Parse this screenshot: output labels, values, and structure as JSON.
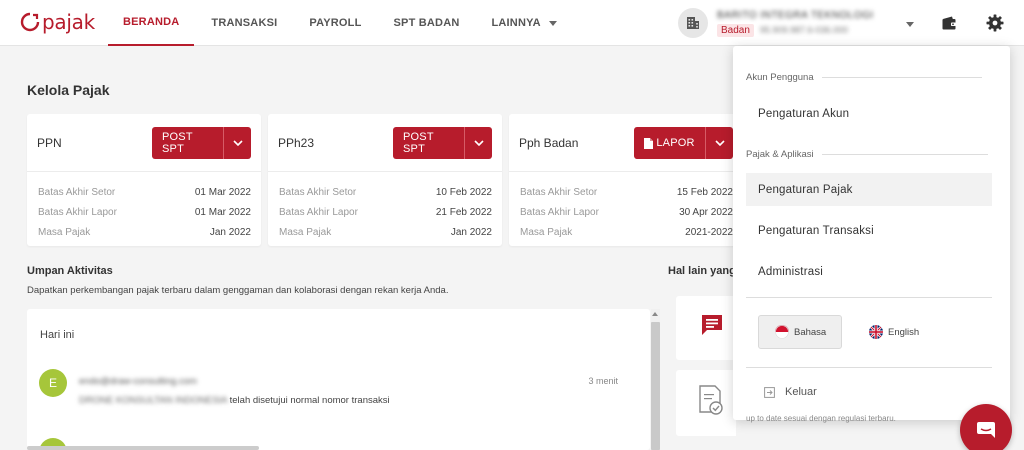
{
  "brand": {
    "logo_text": "pajak",
    "color": "#b71c2c"
  },
  "nav": {
    "items": [
      {
        "label": "BERANDA",
        "active": true
      },
      {
        "label": "TRANSAKSI",
        "active": false
      },
      {
        "label": "PAYROLL",
        "active": false
      },
      {
        "label": "SPT BADAN",
        "active": false
      },
      {
        "label": "LAINNYA",
        "active": false
      }
    ]
  },
  "company": {
    "name": "BARITO INTEGRA TEKNOLOGI",
    "type_badge": "Badan",
    "npwp": "95.909.987.6-036.000"
  },
  "main": {
    "title": "Kelola Pajak",
    "cards": [
      {
        "name": "PPN",
        "action_label": "POST SPT",
        "action_icon": "",
        "rows": [
          {
            "k": "Batas Akhir Setor",
            "v": "01 Mar 2022"
          },
          {
            "k": "Batas Akhir Lapor",
            "v": "01 Mar 2022"
          },
          {
            "k": "Masa Pajak",
            "v": "Jan 2022"
          }
        ]
      },
      {
        "name": "PPh23",
        "action_label": "POST SPT",
        "action_icon": "",
        "rows": [
          {
            "k": "Batas Akhir Setor",
            "v": "10 Feb 2022"
          },
          {
            "k": "Batas Akhir Lapor",
            "v": "21 Feb 2022"
          },
          {
            "k": "Masa Pajak",
            "v": "Jan 2022"
          }
        ]
      },
      {
        "name": "Pph Badan",
        "action_label": "LAPOR",
        "action_icon": "document-icon",
        "rows": [
          {
            "k": "Batas Akhir Setor",
            "v": "15 Feb 2022"
          },
          {
            "k": "Batas Akhir Lapor",
            "v": "30 Apr 2022"
          },
          {
            "k": "Masa Pajak",
            "v": "2021-2022"
          }
        ]
      }
    ],
    "activity": {
      "title": "Umpan Aktivitas",
      "description": "Dapatkan perkembangan pajak terbaru dalam genggaman dan kolaborasi dengan rekan kerja Anda.",
      "today_label": "Hari ini",
      "items": [
        {
          "avatar_letter": "E",
          "email": "endo@draw-consulting.com",
          "company": "DRONE KONSULTAN INDONESIA",
          "message": "telah disetujui normal nomor transaksi",
          "time": "3 menit"
        }
      ]
    },
    "other": {
      "title": "Hal lain yang"
    }
  },
  "menu": {
    "group_account": "Akun Pengguna",
    "account_settings": "Pengaturan Akun",
    "group_tax": "Pajak & Aplikasi",
    "tax_settings": "Pengaturan Pajak",
    "transaction_settings": "Pengaturan Transaksi",
    "administration": "Administrasi",
    "lang_id": "Bahasa",
    "lang_en": "English",
    "logout": "Keluar",
    "below_text": "up to date sesuai dengan regulasi terbaru."
  }
}
